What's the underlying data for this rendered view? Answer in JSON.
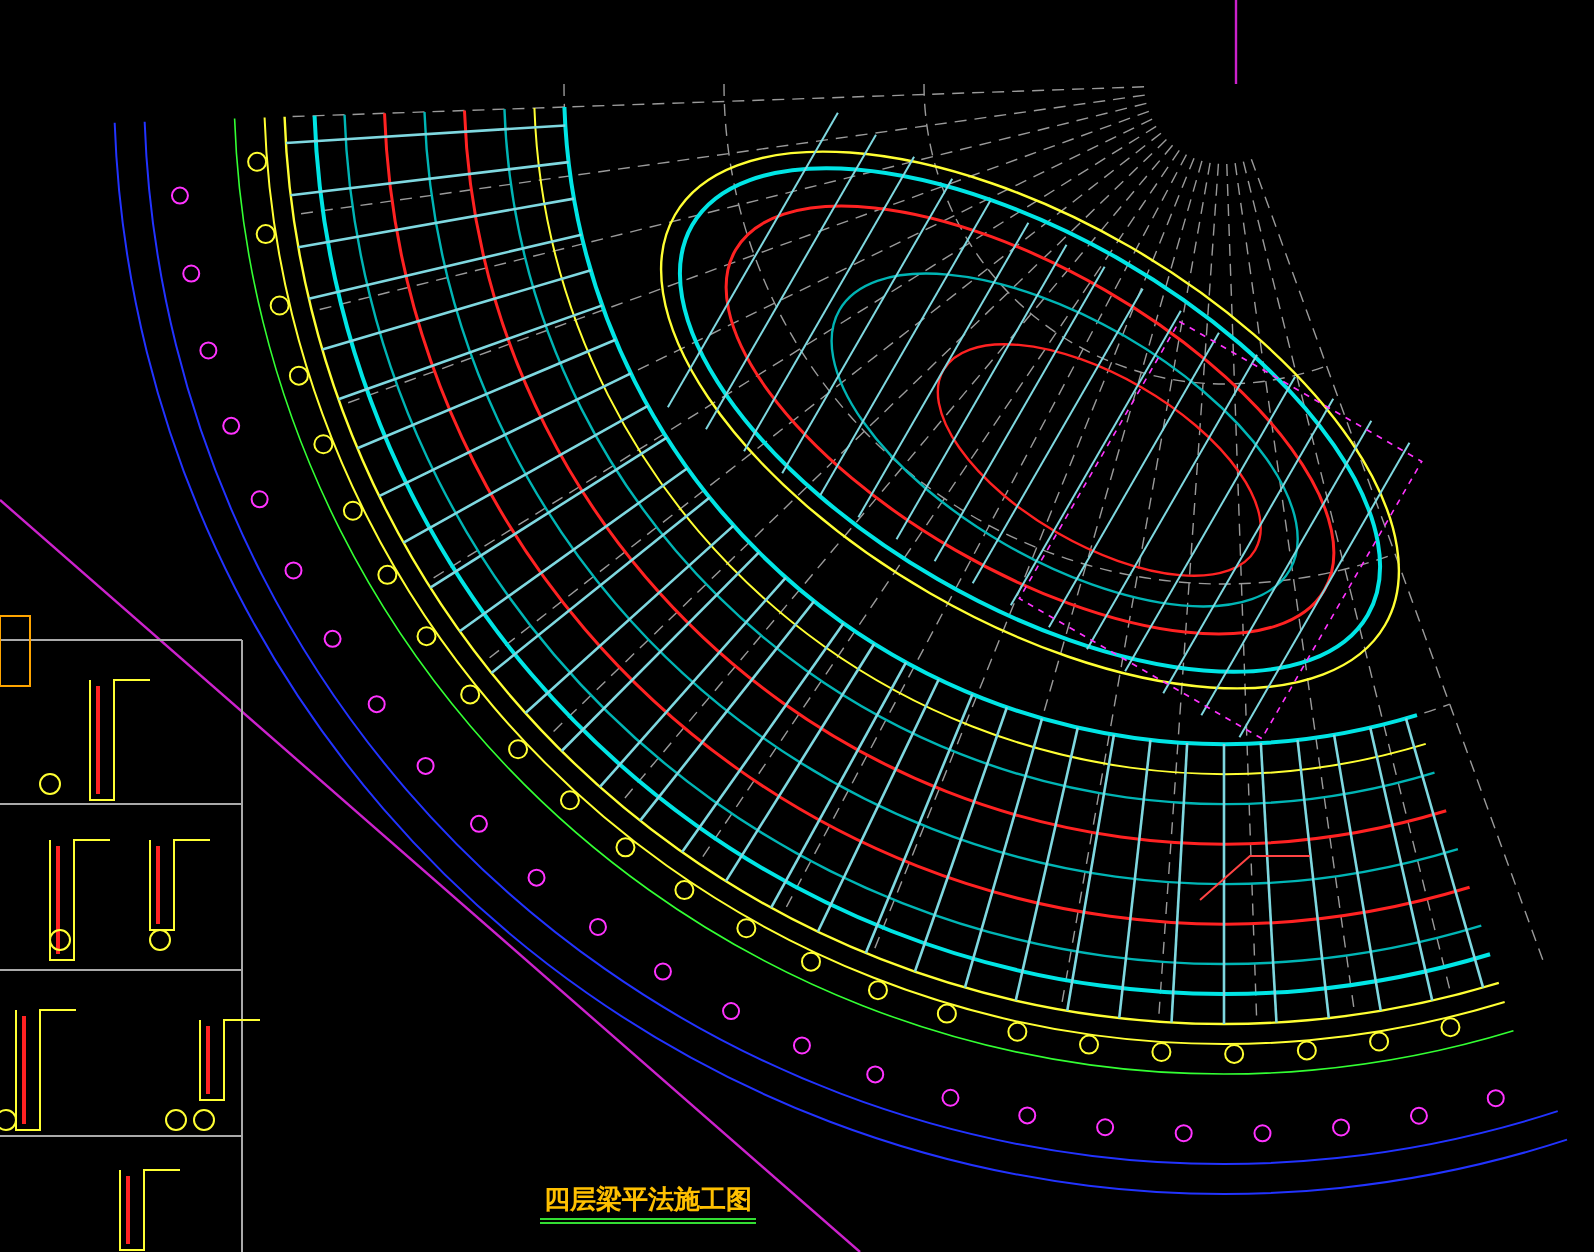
{
  "drawing": {
    "title": "四层梁平法施工图"
  }
}
